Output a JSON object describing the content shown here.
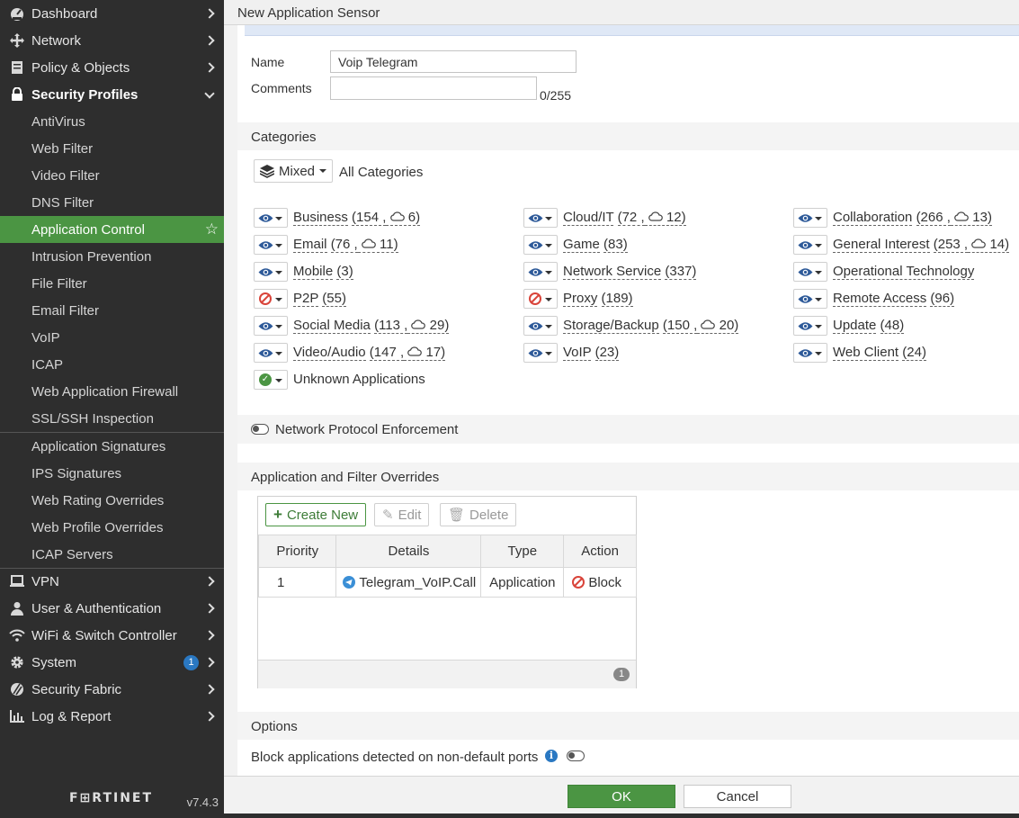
{
  "sidebar": {
    "items": [
      {
        "label": "Dashboard",
        "icon": "dashboard-icon"
      },
      {
        "label": "Network",
        "icon": "network-icon"
      },
      {
        "label": "Policy & Objects",
        "icon": "policy-icon"
      },
      {
        "label": "Security Profiles",
        "icon": "lock-icon"
      },
      {
        "label": "AntiVirus"
      },
      {
        "label": "Web Filter"
      },
      {
        "label": "Video Filter"
      },
      {
        "label": "DNS Filter"
      },
      {
        "label": "Application Control"
      },
      {
        "label": "Intrusion Prevention"
      },
      {
        "label": "File Filter"
      },
      {
        "label": "Email Filter"
      },
      {
        "label": "VoIP"
      },
      {
        "label": "ICAP"
      },
      {
        "label": "Web Application Firewall"
      },
      {
        "label": "SSL/SSH Inspection"
      },
      {
        "label": "Application Signatures"
      },
      {
        "label": "IPS Signatures"
      },
      {
        "label": "Web Rating Overrides"
      },
      {
        "label": "Web Profile Overrides"
      },
      {
        "label": "ICAP Servers"
      },
      {
        "label": "VPN",
        "icon": "laptop-icon"
      },
      {
        "label": "User & Authentication",
        "icon": "user-icon"
      },
      {
        "label": "WiFi & Switch Controller",
        "icon": "wifi-icon"
      },
      {
        "label": "System",
        "icon": "gear-icon",
        "badge": "1"
      },
      {
        "label": "Security Fabric",
        "icon": "fabric-icon"
      },
      {
        "label": "Log & Report",
        "icon": "chart-icon"
      }
    ],
    "logo": "F⊞RTINET",
    "version": "v7.4.3",
    "accent": "#4b9543"
  },
  "page": {
    "title": "New Application Sensor"
  },
  "form": {
    "name_label": "Name",
    "name_value": "Voip Telegram",
    "comments_label": "Comments",
    "comments_count": "0/255"
  },
  "categories": {
    "heading": "Categories",
    "mixed_label": "Mixed",
    "all_label": "All Categories",
    "items": [
      {
        "name": "Business",
        "count": "(154 ,",
        "cloud": "6)",
        "action": "monitor"
      },
      {
        "name": "Cloud/IT",
        "count": "(72 ,",
        "cloud": "12)",
        "action": "monitor"
      },
      {
        "name": "Collaboration",
        "count": "(266 ,",
        "cloud": "13)",
        "action": "monitor"
      },
      {
        "name": "Email",
        "count": "(76 ,",
        "cloud": "11)",
        "action": "monitor"
      },
      {
        "name": "Game",
        "count": "(83)",
        "action": "monitor"
      },
      {
        "name": "General Interest",
        "count": "(253 ,",
        "cloud": "14)",
        "action": "monitor"
      },
      {
        "name": "Mobile",
        "count": "(3)",
        "action": "monitor"
      },
      {
        "name": "Network Service",
        "count": "(337)",
        "action": "monitor"
      },
      {
        "name": "Operational Technology",
        "count": "",
        "action": "monitor"
      },
      {
        "name": "P2P",
        "count": "(55)",
        "action": "block"
      },
      {
        "name": "Proxy",
        "count": "(189)",
        "action": "block"
      },
      {
        "name": "Remote Access",
        "count": "(96)",
        "action": "monitor"
      },
      {
        "name": "Social Media",
        "count": "(113 ,",
        "cloud": "29)",
        "action": "monitor"
      },
      {
        "name": "Storage/Backup",
        "count": "(150 ,",
        "cloud": "20)",
        "action": "monitor"
      },
      {
        "name": "Update",
        "count": "(48)",
        "action": "monitor"
      },
      {
        "name": "Video/Audio",
        "count": "(147 ,",
        "cloud": "17)",
        "action": "monitor"
      },
      {
        "name": "VoIP",
        "count": "(23)",
        "action": "monitor"
      },
      {
        "name": "Web Client",
        "count": "(24)",
        "action": "monitor"
      },
      {
        "name": "Unknown Applications",
        "count": "",
        "action": "allow"
      }
    ]
  },
  "protocol": {
    "label": "Network Protocol Enforcement"
  },
  "overrides": {
    "heading": "Application and Filter Overrides",
    "create_label": "Create New",
    "edit_label": "Edit",
    "delete_label": "Delete",
    "columns": [
      "Priority",
      "Details",
      "Type",
      "Action"
    ],
    "rows": [
      {
        "priority": "1",
        "details": "Telegram_VoIP.Call",
        "type": "Application",
        "action": "Block"
      }
    ],
    "row_count": "1"
  },
  "options": {
    "heading": "Options",
    "nondefault_label": "Block applications detected on non-default ports"
  },
  "buttons": {
    "ok": "OK",
    "cancel": "Cancel"
  },
  "colors": {
    "block_red": "#d9443a",
    "allow_green": "#4b9543",
    "info_blue": "#2a78c2"
  }
}
